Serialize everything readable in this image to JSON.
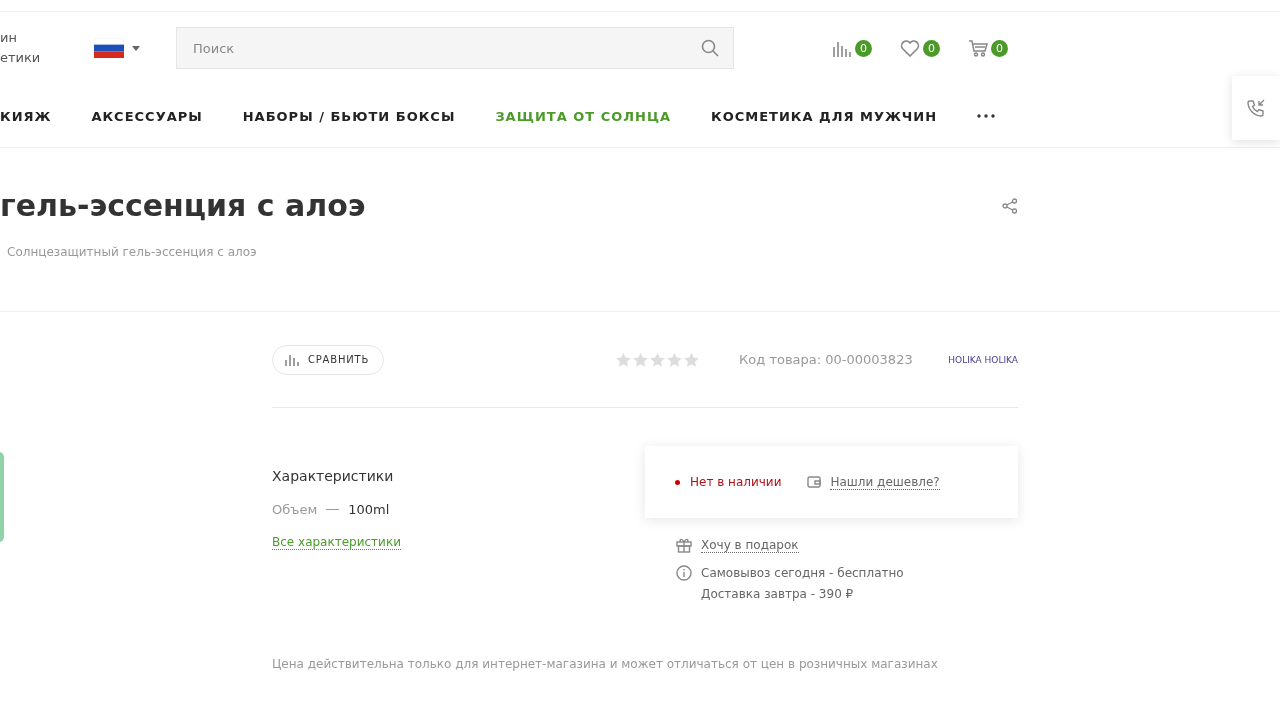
{
  "header": {
    "logo_lines": [
      "ин",
      "етики"
    ],
    "search": {
      "placeholder": "Поиск"
    },
    "counters": [
      {
        "kind": "compare",
        "count": "0"
      },
      {
        "kind": "favorites",
        "count": "0"
      },
      {
        "kind": "cart",
        "count": "0"
      }
    ]
  },
  "nav": [
    {
      "label": "КИЯЖ",
      "selected": false
    },
    {
      "label": "АКСЕССУАРЫ",
      "selected": false
    },
    {
      "label": "НАБОРЫ / БЬЮТИ БОКСЫ",
      "selected": false
    },
    {
      "label": "ЗАЩИТА ОТ СОЛНЦА",
      "selected": true
    },
    {
      "label": "КОСМЕТИКА ДЛЯ МУЖЧИН",
      "selected": false
    }
  ],
  "product": {
    "title": "гель-эссенция с алоэ",
    "breadcrumb": "Солнцезащитный гель-эссенция с алоэ",
    "compare_button": "СРАВНИТЬ",
    "stars": 0,
    "code": "Код товара: 00-00003823",
    "brand": "HOLIKA HOLIKA",
    "characteristics": {
      "title": "Характеристики",
      "props": [
        {
          "name": "Объем",
          "value": "100ml"
        }
      ],
      "link": "Все характеристики"
    },
    "availability": {
      "status": "Нет в наличии",
      "in_stock": false,
      "cheaper_link": "Нашли дешевле?"
    },
    "gift_link": "Хочу в подарок",
    "delivery": [
      "Самовывоз сегодня - бесплатно",
      "Доставка завтра - 390 ₽"
    ],
    "note": "Цена действительна только для интернет-магазина и может отличаться от цен в розничных магазинах"
  }
}
